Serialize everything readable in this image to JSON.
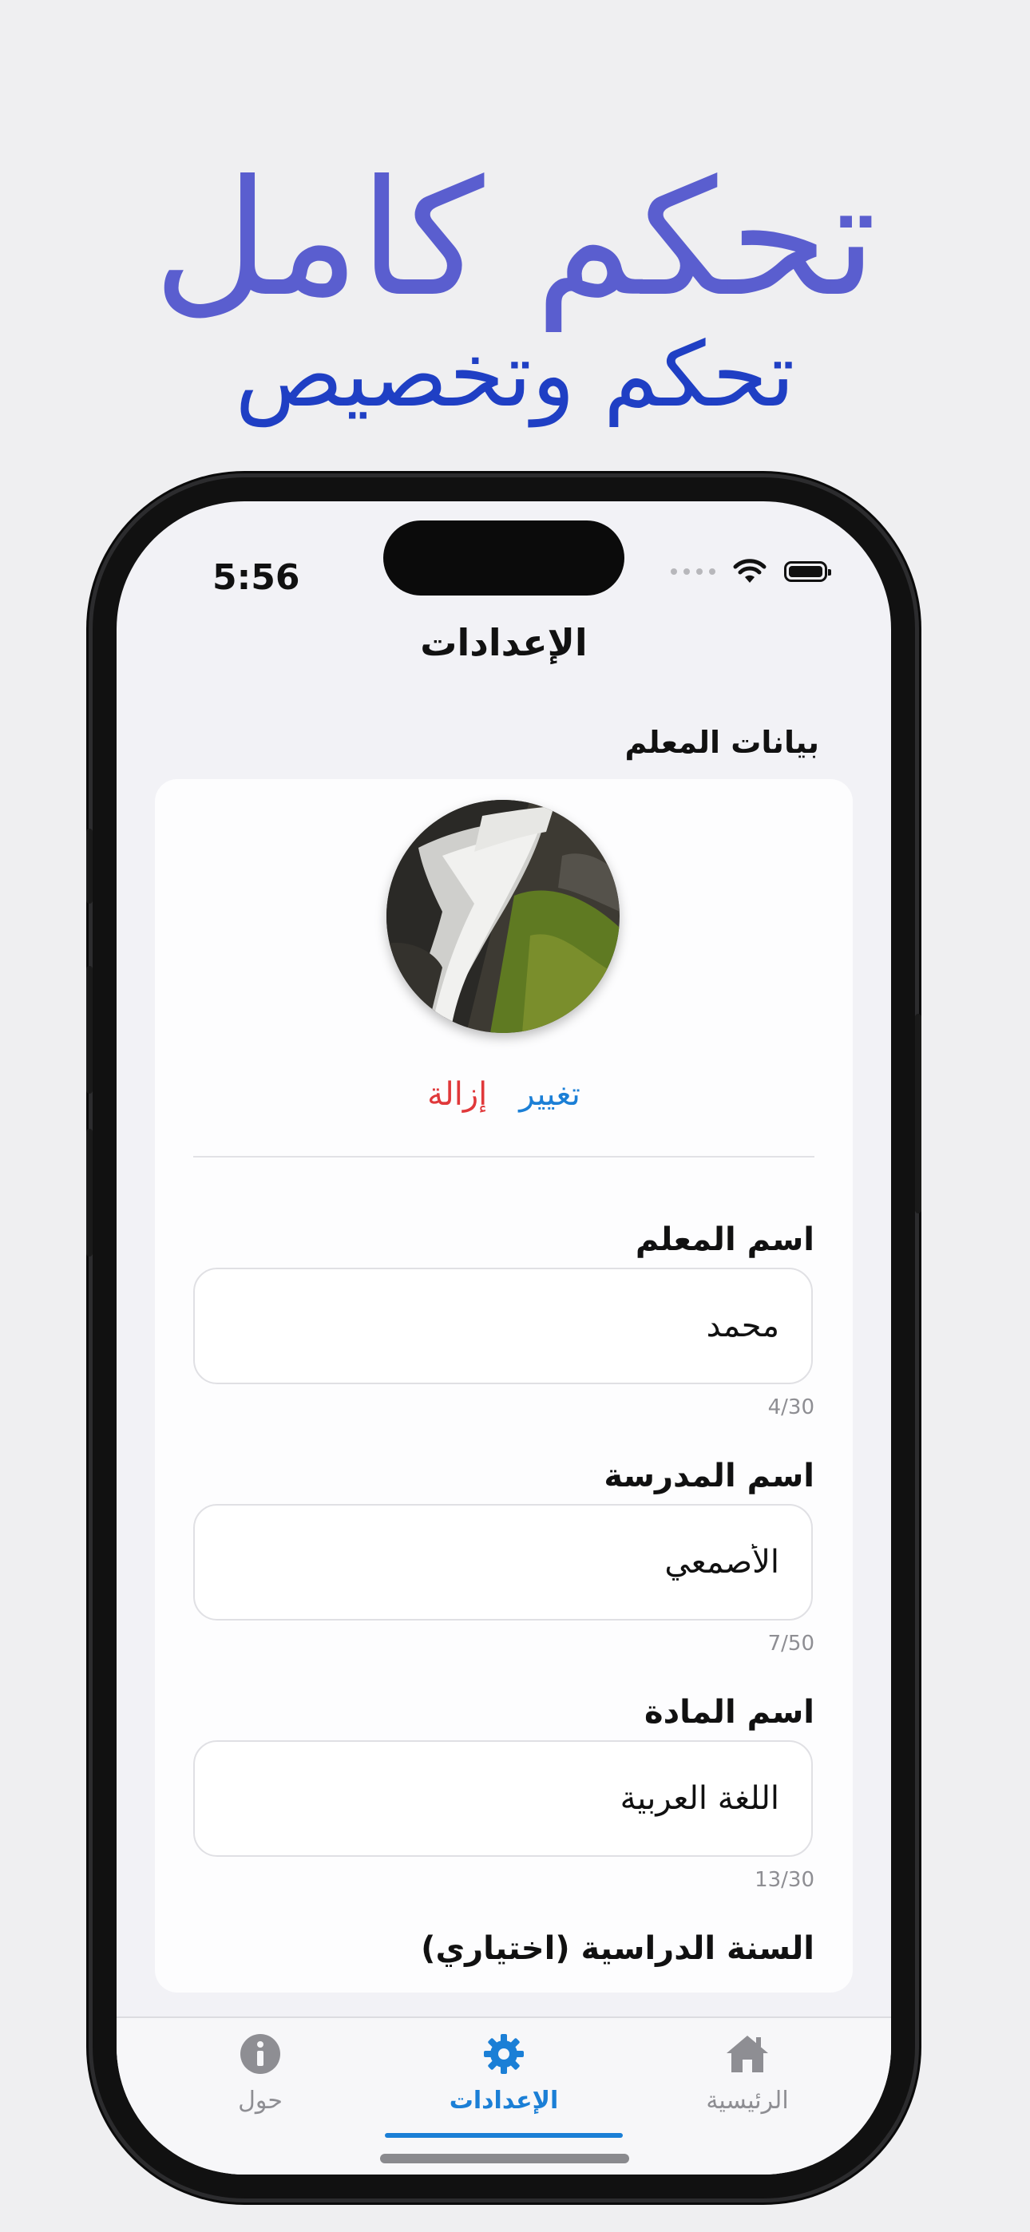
{
  "promo": {
    "headline": "تحكم كامل",
    "subheadline": "تحكم وتخصيص"
  },
  "status_bar": {
    "time": "5:56"
  },
  "nav": {
    "title": "الإعدادات"
  },
  "teacher_section": {
    "title": "بيانات المعلم",
    "photo_change_label": "تغيير",
    "photo_remove_label": "إزالة"
  },
  "fields": [
    {
      "label": "اسم المعلم",
      "value": "محمد",
      "counter": "4/30"
    },
    {
      "label": "اسم المدرسة",
      "value": "الأصمعي",
      "counter": "7/50"
    },
    {
      "label": "اسم المادة",
      "value": "اللغة العربية",
      "counter": "13/30"
    },
    {
      "label": "السنة الدراسية (اختياري)"
    }
  ],
  "tabs": [
    {
      "label": "الرئيسية",
      "icon": "home-icon",
      "active": false
    },
    {
      "label": "الإعدادات",
      "icon": "gear-icon",
      "active": true
    },
    {
      "label": "حول",
      "icon": "info-icon",
      "active": false
    }
  ],
  "colors": {
    "accent": "#1b7fd6",
    "destructive": "#e0383a",
    "headline": "#5a5ecf",
    "subheadline": "#1f3fc4"
  }
}
